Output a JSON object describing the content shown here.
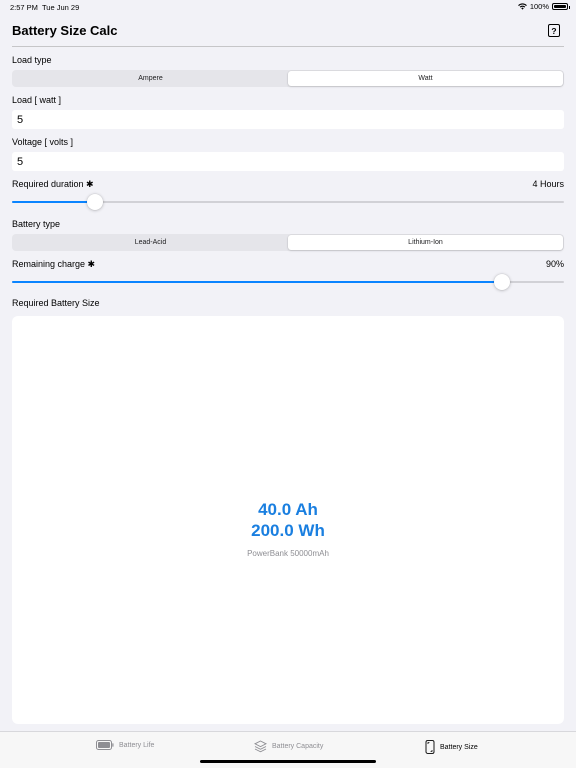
{
  "status_bar": {
    "time": "2:57 PM",
    "date": "Tue Jun 29",
    "battery": "100%"
  },
  "nav": {
    "title": "Battery Size Calc",
    "help_label": "?"
  },
  "load_type": {
    "label": "Load type",
    "options": [
      "Ampere",
      "Watt"
    ],
    "selected": "Watt"
  },
  "load": {
    "label": "Load [ watt ]",
    "value": "5"
  },
  "voltage": {
    "label": "Voltage [ volts ]",
    "value": "5"
  },
  "duration": {
    "label": "Required duration ✱",
    "value_text": "4 Hours",
    "slider_fraction": 0.15
  },
  "battery_type": {
    "label": "Battery type",
    "options": [
      "Lead-Acid",
      "Lithium-Ion"
    ],
    "selected": "Lithium-Ion"
  },
  "remaining_charge": {
    "label": "Remaining charge ✱",
    "value_text": "90%",
    "slider_fraction": 0.888
  },
  "result": {
    "label": "Required Battery Size",
    "ah": "40.0 Ah",
    "wh": "200.0 Wh",
    "note": "PowerBank 50000mAh"
  },
  "tabs": [
    {
      "label": "Battery Life",
      "icon": "battery-icon",
      "active": false
    },
    {
      "label": "Battery Capacity",
      "icon": "layers-icon",
      "active": false
    },
    {
      "label": "Battery Size",
      "icon": "phone-resize-icon",
      "active": true
    }
  ],
  "colors": {
    "accent": "#0a84ff",
    "result": "#1a7fe0",
    "background": "#f2f2f7"
  }
}
